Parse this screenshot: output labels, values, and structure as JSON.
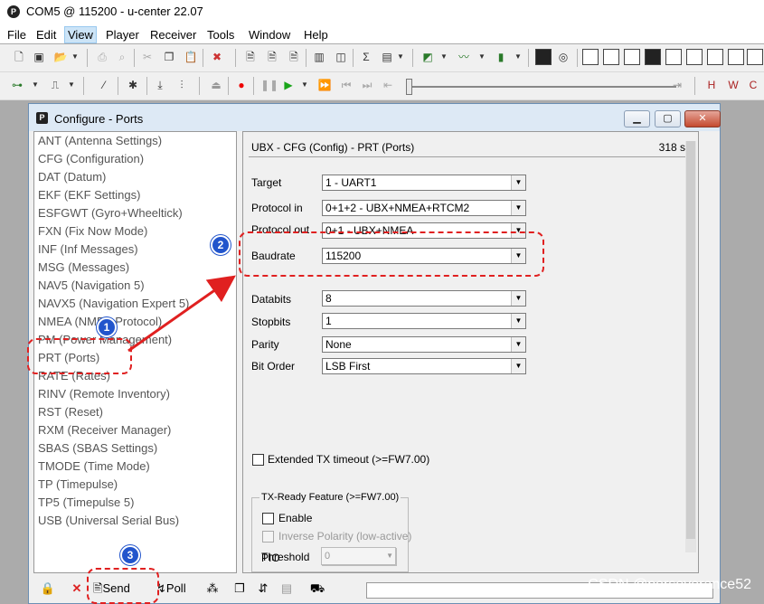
{
  "window": {
    "title": "COM5 @ 115200 - u-center 22.07"
  },
  "menu": [
    "File",
    "Edit",
    "View",
    "Player",
    "Receiver",
    "Tools",
    "Window",
    "Help"
  ],
  "dialog": {
    "title": "Configure - Ports",
    "buttons": {
      "minimize": "▁",
      "maximize": "▢",
      "close": "✕"
    }
  },
  "messages": [
    "ANT (Antenna Settings)",
    "CFG (Configuration)",
    "DAT (Datum)",
    "EKF (EKF Settings)",
    "ESFGWT (Gyro+Wheeltick)",
    "FXN (Fix Now Mode)",
    "INF (Inf Messages)",
    "MSG (Messages)",
    "NAV5 (Navigation 5)",
    "NAVX5 (Navigation Expert 5)",
    "NMEA (NMEA Protocol)",
    "PM (Power Management)",
    "PRT (Ports)",
    "RATE (Rates)",
    "RINV (Remote Inventory)",
    "RST (Reset)",
    "RXM (Receiver Manager)",
    "SBAS (SBAS Settings)",
    "TMODE (Time Mode)",
    "TP (Timepulse)",
    "TP5 (Timepulse 5)",
    "USB (Universal Serial Bus)"
  ],
  "panel": {
    "heading": "UBX - CFG (Config) - PRT (Ports)",
    "age": "318 s",
    "fields": {
      "target": {
        "label": "Target",
        "value": "1 - UART1"
      },
      "protocol_in": {
        "label": "Protocol in",
        "value": "0+1+2 - UBX+NMEA+RTCM2"
      },
      "protocol_out": {
        "label": "Protocol out",
        "value": "0+1 - UBX+NMEA"
      },
      "baudrate": {
        "label": "Baudrate",
        "value": "115200"
      },
      "databits": {
        "label": "Databits",
        "value": "8"
      },
      "stopbits": {
        "label": "Stopbits",
        "value": "1"
      },
      "parity": {
        "label": "Parity",
        "value": "None"
      },
      "bit_order": {
        "label": "Bit Order",
        "value": "LSB First"
      }
    },
    "extended_tx_timeout": "Extended TX timeout (>=FW7.00)",
    "tx_ready": {
      "group_title": "TX-Ready Feature (>=FW7.00)",
      "enable": "Enable",
      "inverse_polarity": "Inverse Polarity (low-active)",
      "threshold_label": "Threshold",
      "threshold_value": "0",
      "pio_label": "PIO",
      "pio_value": "0"
    }
  },
  "bottom_bar": {
    "send_label": "Send",
    "poll_label": "Poll"
  },
  "annotations": {
    "badge1": "1",
    "badge2": "2",
    "badge3": "3",
    "color": "#e02020",
    "badge_color": "#2255cc"
  },
  "watermark": "CSDN @perseverance52"
}
